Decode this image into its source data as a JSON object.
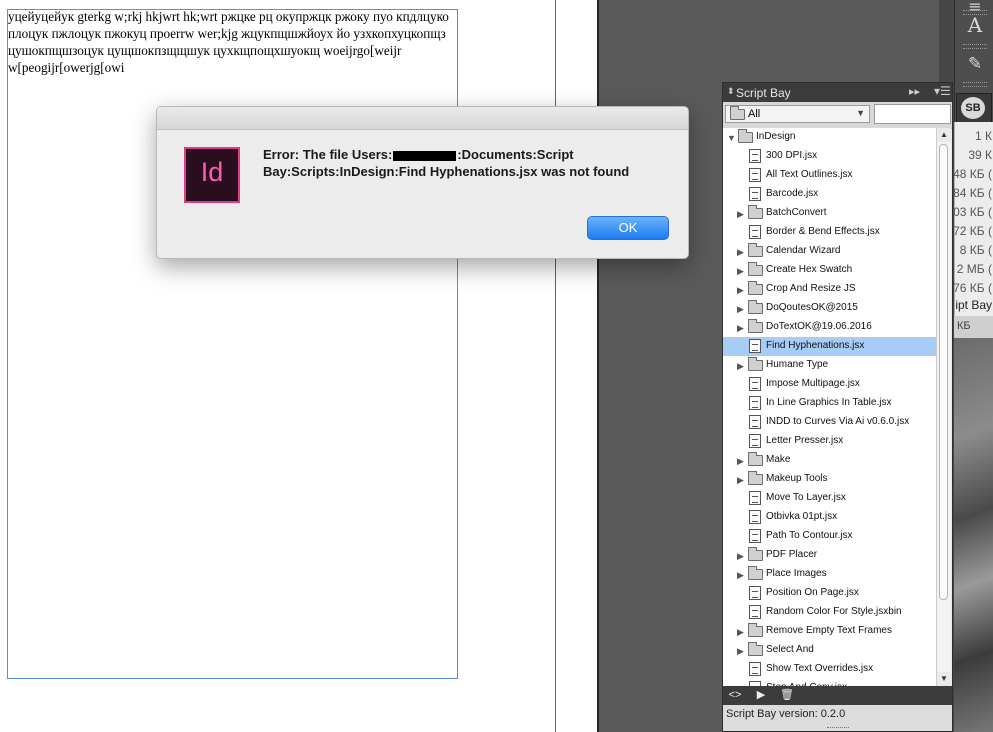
{
  "document": {
    "text": "уцейуцейук gterkg w;rkj hkjwrt hk;wrt ржцке рц окупржцк ржоку пуо кпдлцуко плоцук пжлоцук пжокуц проerrw wer;kjg жцукпщшжйоух йо узхкопхуцкопщз цушокпщшзоцук  цущшокпзщщшук цухкщпощхшуокщ woeijrgo[weijr w[peogijr[owerjg[owi"
  },
  "tools": {
    "type_icon": "A",
    "sb_badge": "SB"
  },
  "file_sizes": [
    "1 К",
    "39 К",
    "48 КБ (",
    "84 КБ (",
    "03 КБ (",
    "72 КБ (",
    "8 КБ (",
    "2 МБ (",
    "76 КБ ("
  ],
  "file_col_name": "ipt Bay",
  "file_col_kb": "КБ",
  "panel": {
    "title": "Script Bay",
    "filter_label": "All",
    "search_value": "",
    "tree": [
      {
        "label": "InDesign",
        "type": "folder-open",
        "indent": 0
      },
      {
        "label": "300 DPI.jsx",
        "type": "file",
        "indent": 1
      },
      {
        "label": "All Text Outlines.jsx",
        "type": "file",
        "indent": 1
      },
      {
        "label": "Barcode.jsx",
        "type": "file",
        "indent": 1
      },
      {
        "label": "BatchConvert",
        "type": "folder",
        "indent": 1
      },
      {
        "label": "Border & Bend Effects.jsx",
        "type": "file",
        "indent": 1
      },
      {
        "label": "Calendar Wizard",
        "type": "folder",
        "indent": 1
      },
      {
        "label": "Create Hex Swatch",
        "type": "folder",
        "indent": 1
      },
      {
        "label": "Crop And Resize JS",
        "type": "folder",
        "indent": 1
      },
      {
        "label": "DoQoutesOK@2015",
        "type": "folder",
        "indent": 1
      },
      {
        "label": "DoTextOK@19.06.2016",
        "type": "folder",
        "indent": 1
      },
      {
        "label": "Find Hyphenations.jsx",
        "type": "file",
        "indent": 1,
        "selected": true
      },
      {
        "label": "Humane Type",
        "type": "folder",
        "indent": 1
      },
      {
        "label": "Impose Multipage.jsx",
        "type": "file",
        "indent": 1
      },
      {
        "label": "In Line Graphics In Table.jsx",
        "type": "file",
        "indent": 1
      },
      {
        "label": "INDD to Curves Via Ai v0.6.0.jsx",
        "type": "file",
        "indent": 1
      },
      {
        "label": "Letter Presser.jsx",
        "type": "file",
        "indent": 1
      },
      {
        "label": "Make",
        "type": "folder",
        "indent": 1
      },
      {
        "label": "Makeup Tools",
        "type": "folder",
        "indent": 1
      },
      {
        "label": "Move To Layer.jsx",
        "type": "file",
        "indent": 1
      },
      {
        "label": "Otbivka 01pt.jsx",
        "type": "file",
        "indent": 1
      },
      {
        "label": "Path To Contour.jsx",
        "type": "file",
        "indent": 1
      },
      {
        "label": "PDF Placer",
        "type": "folder",
        "indent": 1
      },
      {
        "label": "Place Images",
        "type": "folder",
        "indent": 1
      },
      {
        "label": "Position On Page.jsx",
        "type": "file",
        "indent": 1
      },
      {
        "label": "Random Color For Style.jsxbin",
        "type": "file",
        "indent": 1
      },
      {
        "label": "Remove Empty Text Frames",
        "type": "folder",
        "indent": 1
      },
      {
        "label": "Select And",
        "type": "folder",
        "indent": 1
      },
      {
        "label": "Show Text Overrides.jsx",
        "type": "file",
        "indent": 1
      },
      {
        "label": "Stop And Copy.jsx",
        "type": "file",
        "indent": 1
      }
    ],
    "status": "Script Bay version: 0.2.0"
  },
  "dialog": {
    "app_icon_text": "Id",
    "message_part1": "Error: The file Users:",
    "message_part2": ":Documents:Script Bay:Scripts:InDesign:Find Hyphenations.jsx was not found",
    "ok_label": "OK"
  }
}
